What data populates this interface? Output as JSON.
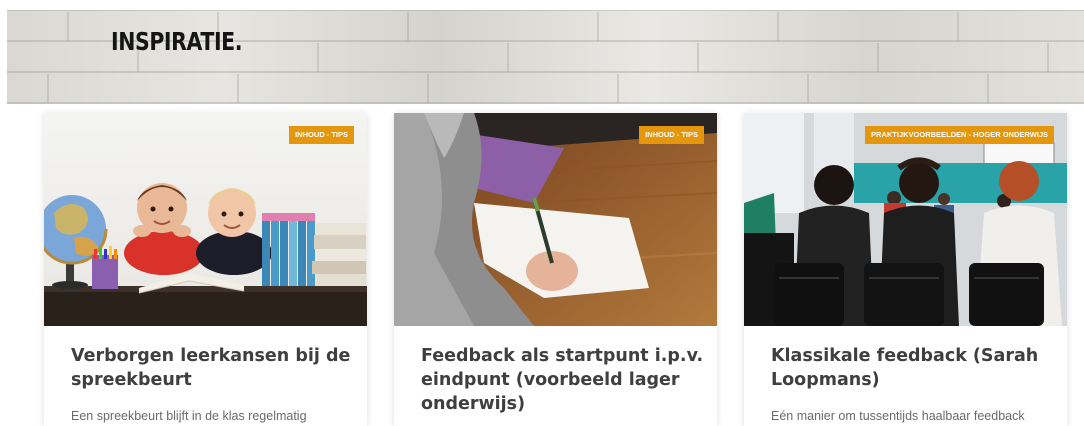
{
  "header": {
    "title": "INSPIRATIE."
  },
  "cards": [
    {
      "badge": "INHOUD - TIPS",
      "title": "Verborgen leerkansen bij de spreekbeurt",
      "excerpt": "Een spreekbeurt blijft in de klas regelmatig",
      "image": "children-with-globe-and-books"
    },
    {
      "badge": "INHOUD - TIPS",
      "title": "Feedback als startpunt i.p.v. eindpunt (voorbeeld lager onderwijs)",
      "excerpt": "",
      "image": "student-writing-on-paper"
    },
    {
      "badge": "PRAKTIJKVOORBEELDEN - HOGER ONDERWIJS",
      "title": "Klassikale feedback (Sarah Loopmans)",
      "excerpt": "Eén manier om tussentijds haalbaar feedback",
      "image": "students-in-lecture-hall"
    }
  ],
  "colors": {
    "badge": "#e4960c",
    "title": "#3f3f3f",
    "excerpt": "#6a6a6a"
  }
}
